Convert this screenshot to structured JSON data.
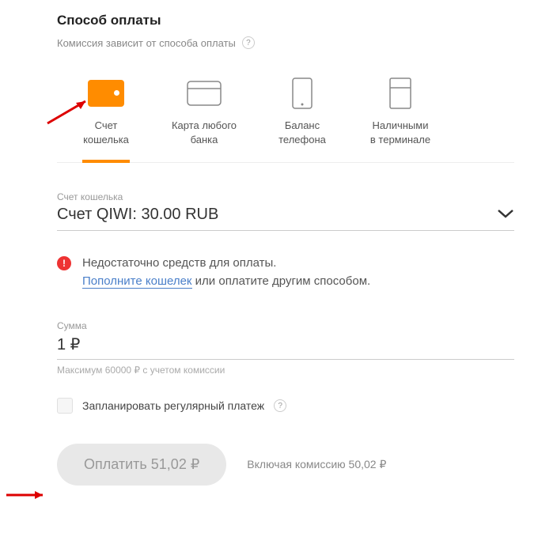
{
  "title": "Способ оплаты",
  "subtitle": "Комиссия зависит от способа оплаты",
  "methods": [
    {
      "label1": "Счет",
      "label2": "кошелька"
    },
    {
      "label1": "Карта любого",
      "label2": "банка"
    },
    {
      "label1": "Баланс",
      "label2": "телефона"
    },
    {
      "label1": "Наличными",
      "label2": "в терминале"
    }
  ],
  "account": {
    "label": "Счет кошелька",
    "value": "Счет QIWI: 30.00 RUB"
  },
  "alert": {
    "line1": "Недостаточно средств для оплаты.",
    "link": "Пополните кошелек",
    "line2_rest": " или оплатите другим способом."
  },
  "amount": {
    "label": "Сумма",
    "value": "1 ₽",
    "hint": "Максимум 60000 ₽ с учетом комиссии"
  },
  "recurring_label": "Запланировать регулярный платеж",
  "pay_button": "Оплатить 51,02 ₽",
  "fee_text": "Включая комиссию 50,02 ₽"
}
